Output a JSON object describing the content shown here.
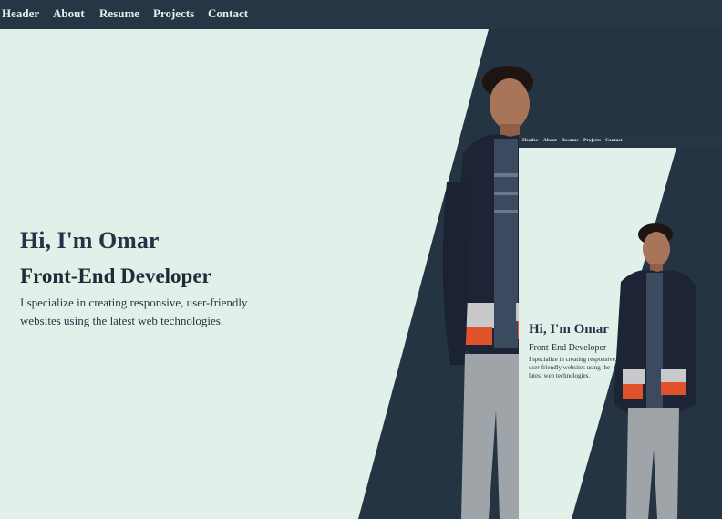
{
  "nav": {
    "items": [
      {
        "label": "Header"
      },
      {
        "label": "About"
      },
      {
        "label": "Resume"
      },
      {
        "label": "Projects"
      },
      {
        "label": "Contact"
      }
    ]
  },
  "hero": {
    "title": "Hi, I'm Omar",
    "subtitle": "Front-End Developer",
    "description": "I specialize in creating responsive, user-friendly websites using the latest web technologies."
  },
  "preview": {
    "nav": [
      "Header",
      "About",
      "Resume",
      "Projects",
      "Contact"
    ],
    "title": "Hi, I'm Omar",
    "subtitle": "Front-End Developer",
    "description": "I specialize in creating responsive, user-friendly websites using the latest web technologies."
  },
  "colors": {
    "navy": "#243443",
    "mint": "#e2f0ea",
    "text": "#233445"
  }
}
